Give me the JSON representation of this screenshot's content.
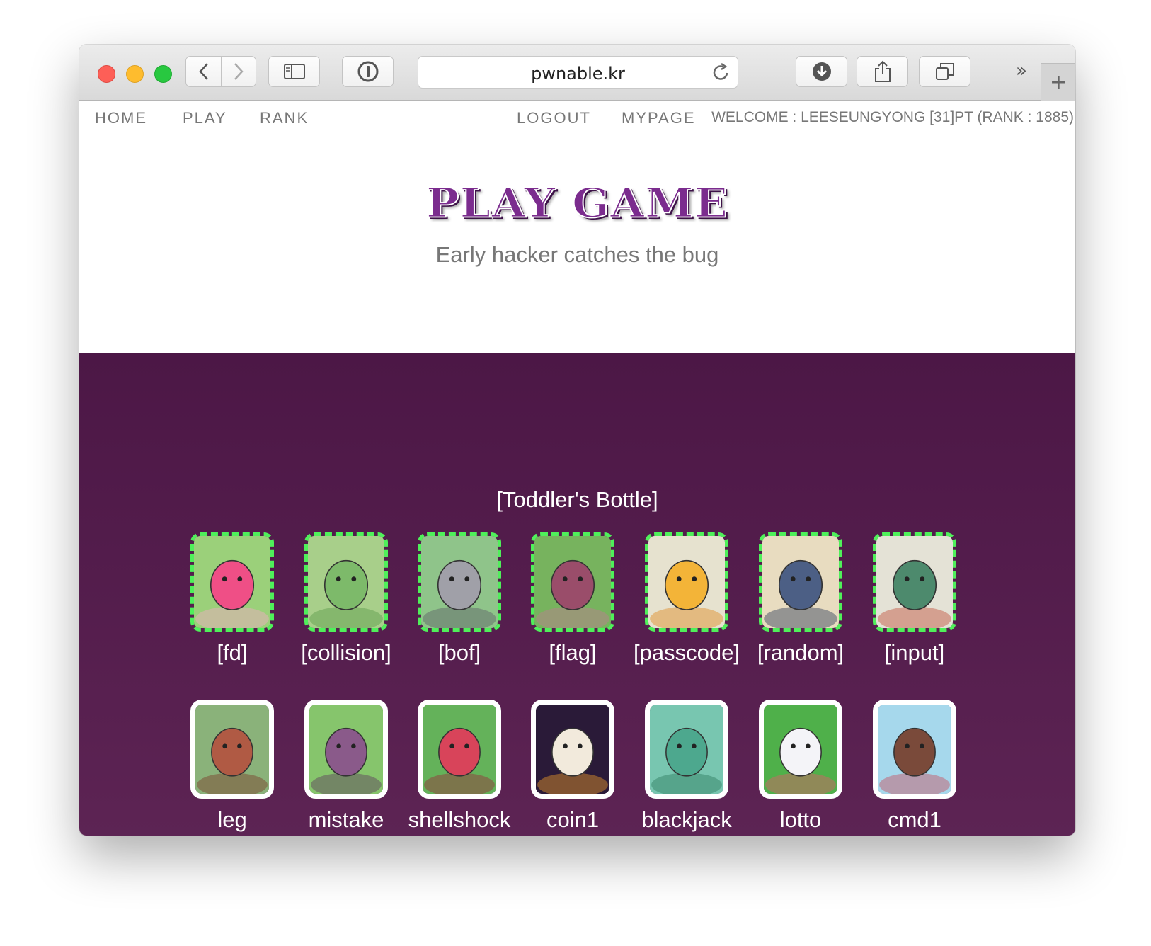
{
  "browser": {
    "url": "pwnable.kr"
  },
  "nav": {
    "home": "HOME",
    "play": "PLAY",
    "rank": "RANK",
    "logout": "LOGOUT",
    "mypage": "MYPAGE",
    "welcome": "WELCOME : LEESEUNGYONG [31]PT (RANK : 1885)"
  },
  "hero": {
    "title": "PLAY GAME",
    "subtitle": "Early hacker catches the bug"
  },
  "section": {
    "title": "[Toddler's Bottle]"
  },
  "challenges_row1": [
    {
      "label": "[fd]",
      "solved": true,
      "icon": "pink-slime-icon"
    },
    {
      "label": "[collision]",
      "solved": true,
      "icon": "caterpillar-icon"
    },
    {
      "label": "[bof]",
      "solved": true,
      "icon": "raccoon-icon"
    },
    {
      "label": "[flag]",
      "solved": true,
      "icon": "cocoon-icon"
    },
    {
      "label": "[passcode]",
      "solved": true,
      "icon": "yellow-bird-icon"
    },
    {
      "label": "[random]",
      "solved": true,
      "icon": "wolf-icon"
    },
    {
      "label": "[input]",
      "solved": true,
      "icon": "mantis-boxer-icon"
    }
  ],
  "challenges_row2": [
    {
      "label": "leg",
      "solved": false,
      "icon": "bear-icon"
    },
    {
      "label": "mistake",
      "solved": false,
      "icon": "monkey-icon"
    },
    {
      "label": "shellshock",
      "solved": false,
      "icon": "plant-monster-icon"
    },
    {
      "label": "coin1",
      "solved": false,
      "icon": "ghost-pumpkin-icon"
    },
    {
      "label": "blackjack",
      "solved": false,
      "icon": "lizard-icon"
    },
    {
      "label": "lotto",
      "solved": false,
      "icon": "white-rabbit-icon"
    },
    {
      "label": "cmd1",
      "solved": false,
      "icon": "mushroom-girl-icon"
    }
  ],
  "colors": {
    "accent": "#7b2c8e",
    "background_top": "#4c1746",
    "background_bottom": "#5d2454",
    "solved_border": "#4ff05a"
  }
}
